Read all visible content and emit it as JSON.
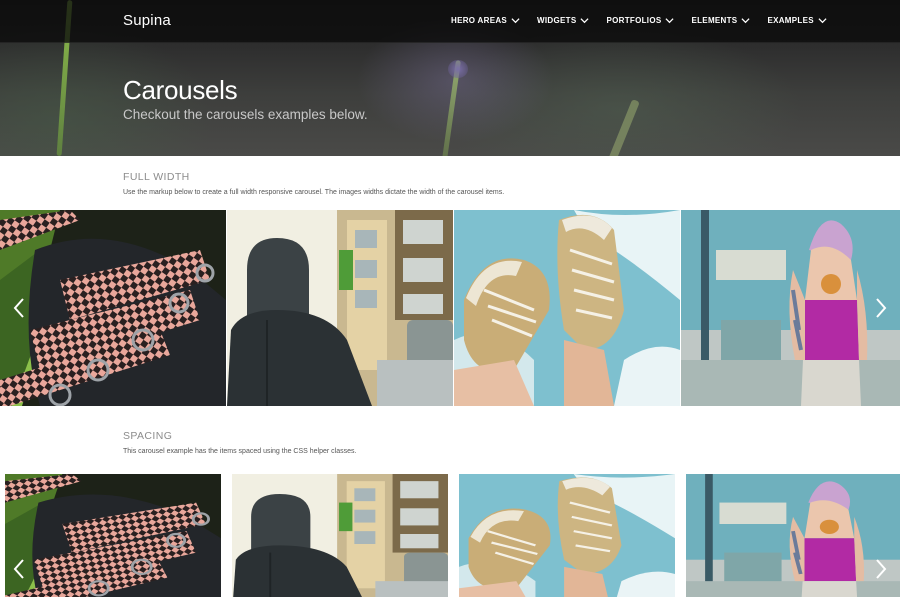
{
  "navbar": {
    "brand": "Supina",
    "items": [
      {
        "label": "HERO AREAS"
      },
      {
        "label": "WIDGETS"
      },
      {
        "label": "PORTFOLIOS"
      },
      {
        "label": "ELEMENTS"
      },
      {
        "label": "EXAMPLES"
      }
    ]
  },
  "hero": {
    "title": "Carousels",
    "subtitle": "Checkout the carousels examples below."
  },
  "sections": {
    "full_width": {
      "heading": "FULL WIDTH",
      "description": "Use the markup below to create a full width responsive carousel. The images widths dictate the width of the carousel items."
    },
    "spacing": {
      "heading": "SPACING",
      "description": "This carousel example has the items spaced using the CSS helper classes."
    }
  },
  "icons": {
    "nav_caret": "chevron-down-icon",
    "prev": "chevron-left-icon",
    "next": "chevron-right-icon"
  },
  "slides": [
    {
      "subject": "shoelace"
    },
    {
      "subject": "hoodie"
    },
    {
      "subject": "sneakers"
    },
    {
      "subject": "tattoo"
    }
  ]
}
